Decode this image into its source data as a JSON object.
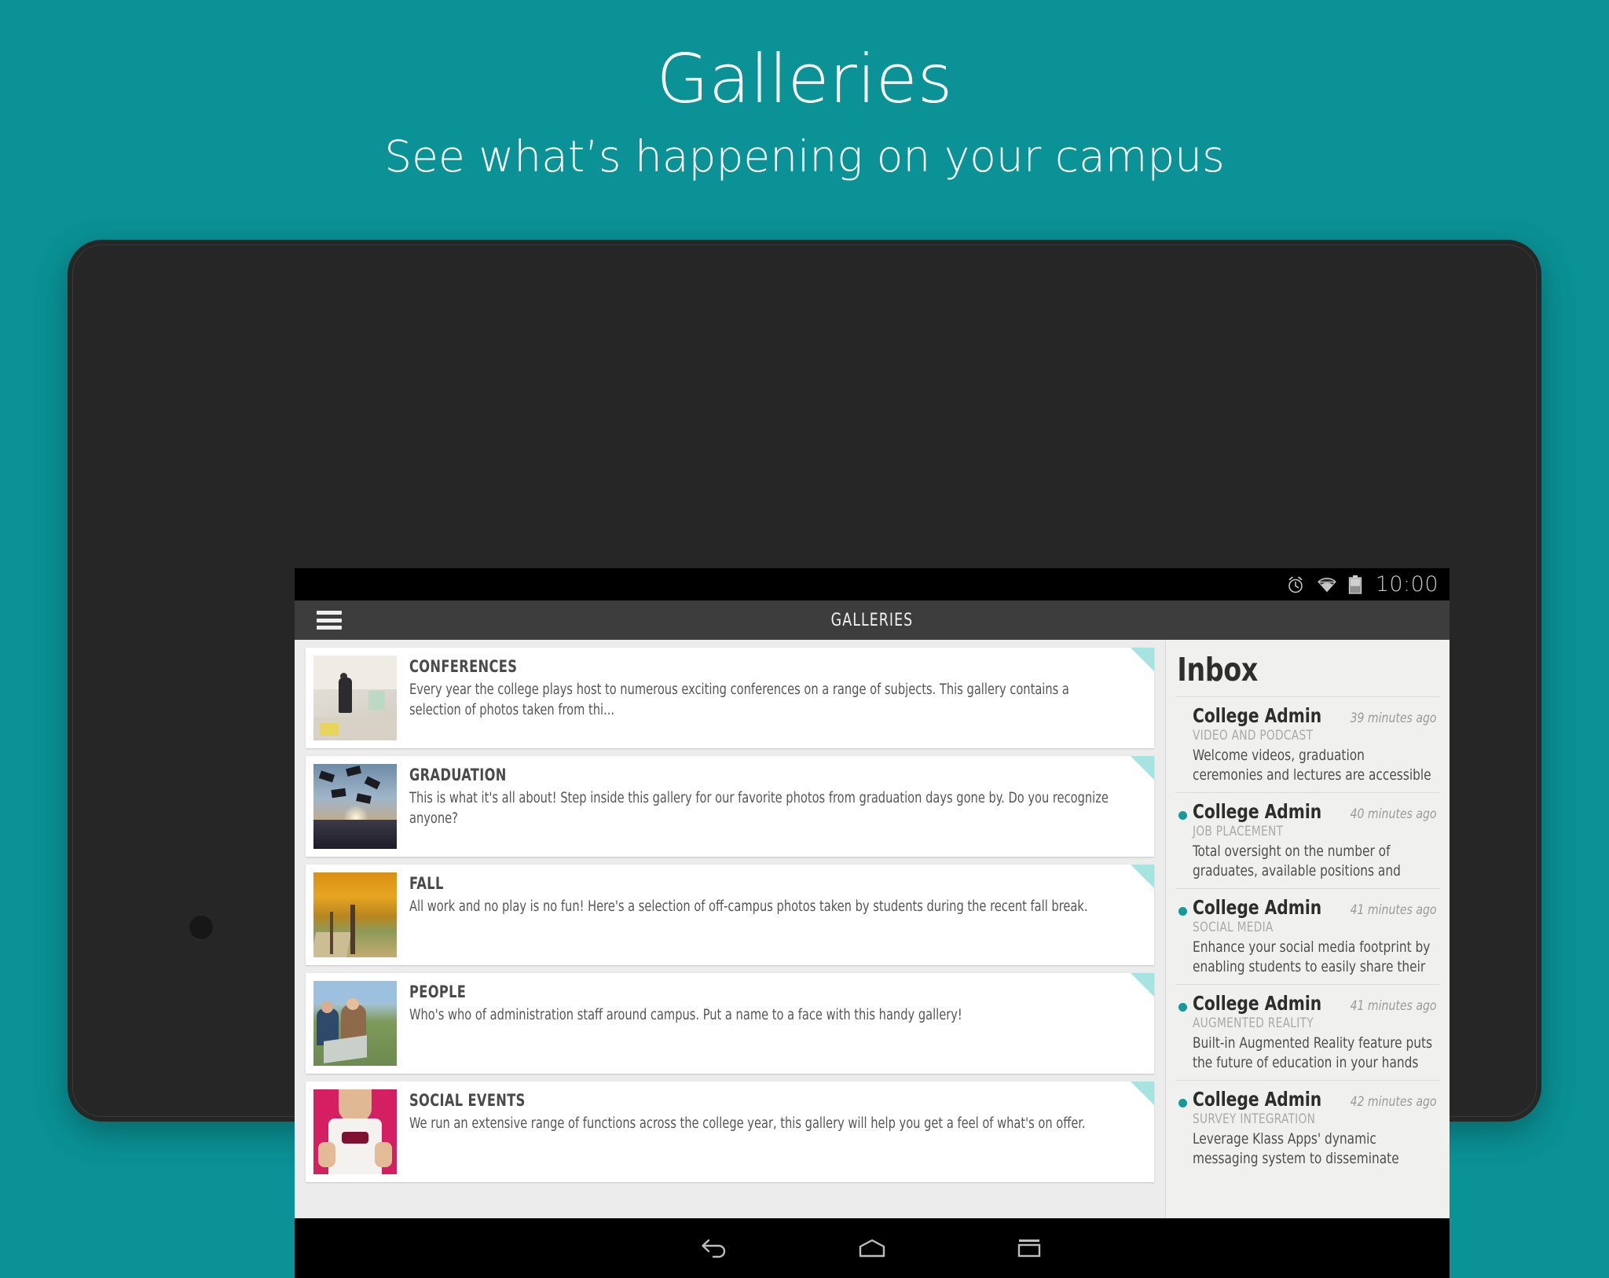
{
  "promo": {
    "title": "Galleries",
    "subtitle": "See what’s happening on your campus",
    "background_color": "#0a9296"
  },
  "status_bar": {
    "time": "10:00",
    "icons": [
      "alarm-icon",
      "wifi-icon",
      "battery-icon"
    ]
  },
  "app_bar": {
    "menu_icon": "hamburger-menu-icon",
    "title": "GALLERIES"
  },
  "galleries": [
    {
      "title": "CONFERENCES",
      "description": "Every year the college plays host to numerous exciting conferences on a range of subjects.  This gallery contains a selection of photos taken from thi...",
      "thumb": "conference-room-photo"
    },
    {
      "title": "GRADUATION",
      "description": "This is what it's all about!  Step inside this gallery for our favorite photos from graduation days gone by.  Do you recognize anyone?",
      "thumb": "graduation-caps-photo"
    },
    {
      "title": "FALL",
      "description": "All work and no play is no fun!  Here's a selection of off-campus photos taken by students during the recent fall break.",
      "thumb": "autumn-trees-photo"
    },
    {
      "title": "PEOPLE",
      "description": "Who's who of administration staff around campus.  Put a name to a face with this handy gallery!",
      "thumb": "students-laptop-photo"
    },
    {
      "title": "SOCIAL EVENTS",
      "description": "We run an extensive range of functions across the college year, this gallery will help you get a feel of what's on offer.",
      "thumb": "bow-tie-photo"
    }
  ],
  "inbox": {
    "heading": "Inbox",
    "unread_dot_color": "#139b96",
    "messages": [
      {
        "sender": "College Admin",
        "time": "39 minutes ago",
        "category": "VIDEO AND PODCAST",
        "preview": "Welcome videos, graduation ceremonies and lectures are accessible",
        "unread": false
      },
      {
        "sender": "College Admin",
        "time": "40 minutes ago",
        "category": "JOB PLACEMENT",
        "preview": "Total oversight on the number of graduates, available positions and",
        "unread": true
      },
      {
        "sender": "College Admin",
        "time": "41 minutes ago",
        "category": "SOCIAL MEDIA",
        "preview": "Enhance your social media footprint by enabling students to easily share their",
        "unread": true
      },
      {
        "sender": "College Admin",
        "time": "41 minutes ago",
        "category": "AUGMENTED REALITY",
        "preview": "Built-in Augmented Reality feature puts the future of education in your hands",
        "unread": true
      },
      {
        "sender": "College Admin",
        "time": "42 minutes ago",
        "category": "SURVEY INTEGRATION",
        "preview": "Leverage Klass Apps' dynamic messaging system to disseminate",
        "unread": true
      }
    ]
  },
  "nav_bar": {
    "buttons": [
      "back-icon",
      "home-icon",
      "recents-icon"
    ]
  }
}
